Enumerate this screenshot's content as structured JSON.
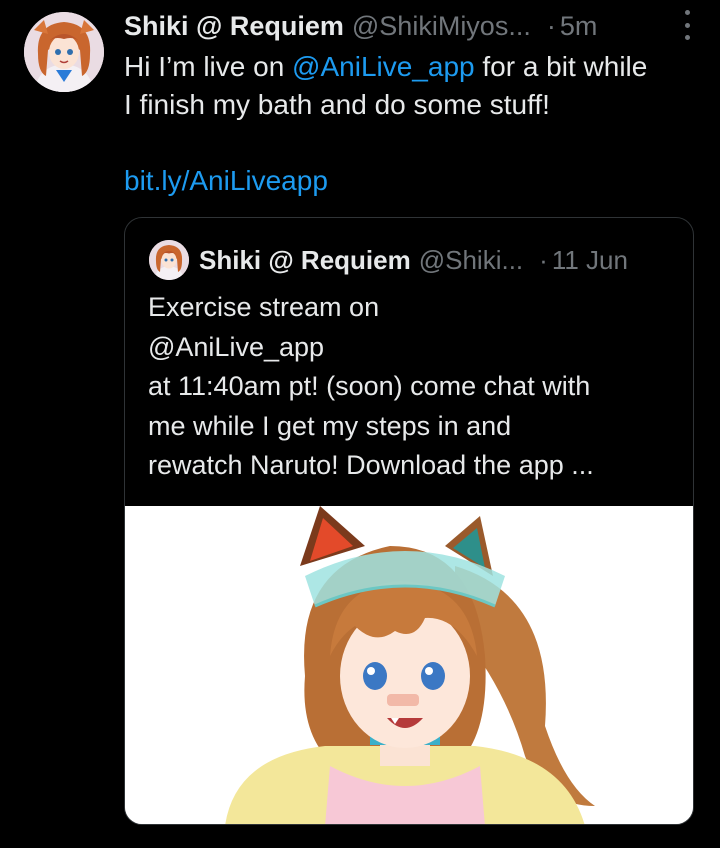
{
  "tweet": {
    "author_name": "Shiki @ Requiem",
    "handle": "@ShikiMiyos...",
    "separator": "·",
    "time": "5m",
    "more_icon": "more-vertical-icon",
    "text_line1_prefix": "Hi I’m live on ",
    "text_line1_link": "@AniLive_app",
    "text_line1_suffix": " for a bit while",
    "text_line2": "I finish my bath and do some stuff!",
    "link_text": "bit.ly/AniLiveapp"
  },
  "quoted_tweet": {
    "author_name": "Shiki @ Requiem",
    "handle": "@Shiki...",
    "separator": "·",
    "time": "11 Jun",
    "text_lines": [
      "Exercise stream on",
      "@AniLive_app",
      "at 11:40am pt! (soon) come chat with",
      "me while I get my steps in and",
      "rewatch Naruto! Download the app ..."
    ]
  },
  "colors": {
    "background": "#000000",
    "text": "#e7e9ea",
    "muted": "#71767b",
    "link": "#1d9bf0",
    "border": "#2f3336"
  }
}
